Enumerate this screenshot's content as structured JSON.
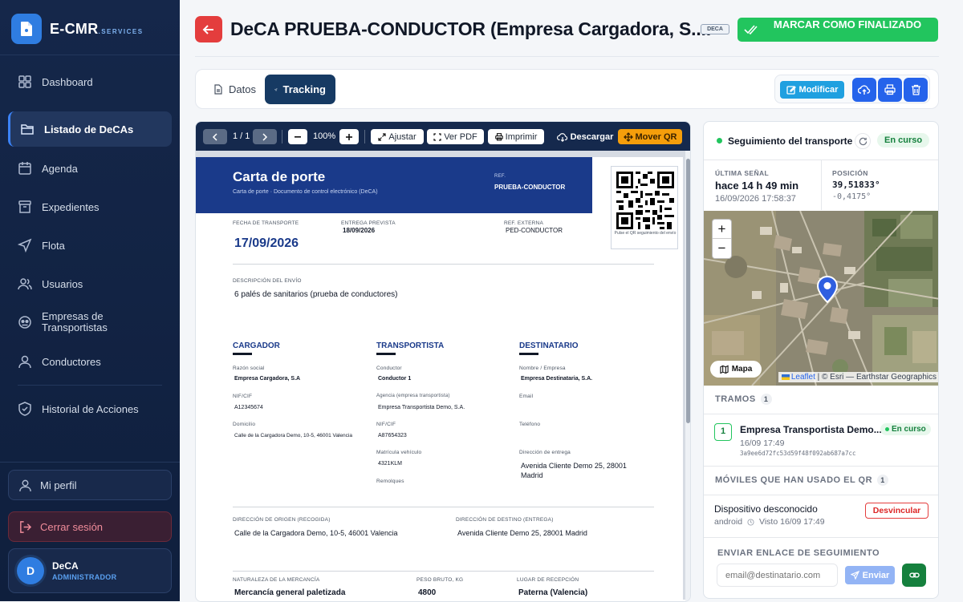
{
  "app": {
    "name": "E-CMR",
    "suffix": ".SERVICES"
  },
  "sidebar": {
    "items": [
      {
        "label": "Dashboard",
        "icon": "grid-icon"
      },
      {
        "label": "Listado de DeCAs",
        "icon": "folder-icon"
      },
      {
        "label": "Agenda",
        "icon": "calendar-icon"
      },
      {
        "label": "Expedientes",
        "icon": "archive-icon"
      },
      {
        "label": "Flota",
        "icon": "navigation-icon"
      },
      {
        "label": "Usuarios",
        "icon": "users-icon"
      },
      {
        "label": "Empresas de Transportistas",
        "icon": "company-icon"
      },
      {
        "label": "Conductores",
        "icon": "user-icon"
      },
      {
        "label": "Historial de Acciones",
        "icon": "shield-icon"
      }
    ],
    "active_index": 1,
    "profile_label": "Mi perfil",
    "logout_label": "Cerrar sesión",
    "user": {
      "initial": "D",
      "name": "DeCA",
      "role": "ADMINISTRADOR"
    }
  },
  "header": {
    "title": "DeCA PRUEBA-CONDUCTOR (Empresa Cargadora, S....",
    "badge": "DECA",
    "finish_label": "MARCAR COMO FINALIZADO"
  },
  "tabs": {
    "datos": "Datos",
    "tracking": "Tracking",
    "modify": "Modificar"
  },
  "pdf": {
    "toolbar": {
      "page": "1 / 1",
      "zoom": "100%",
      "fit": "Ajustar",
      "view_pdf": "Ver PDF",
      "print": "Imprimir",
      "download": "Descargar",
      "move_qr": "Mover QR"
    },
    "doc": {
      "title": "Carta de porte",
      "subtitle": "Carta de porte · Documento de control electrónico (DeCA)",
      "ref_label": "REF.",
      "ref_value": "PRUEBA-CONDUCTOR",
      "qr_caption": "Pulse el QR seguimiento del envío",
      "fecha_label": "FECHA DE TRANSPORTE",
      "fecha_value": "17/09/2026",
      "entrega_label": "ENTREGA PREVISTA",
      "entrega_value": "18/09/2026",
      "refext_label": "REF. EXTERNA",
      "refext_value": "PED-CONDUCTOR",
      "desc_label": "DESCRIPCIÓN DEL ENVÍO",
      "desc_value": "6 palés de sanitarios (prueba de conductores)",
      "cargador": {
        "title": "CARGADOR",
        "razon_label": "Razón social",
        "razon": "Empresa Cargadora, S.A",
        "nif_label": "NIF/CIF",
        "nif": "A12345674",
        "dom_label": "Domicilio",
        "dom": "Calle de la Cargadora Demo, 10-5, 46001 Valencia"
      },
      "transportista": {
        "title": "TRANSPORTISTA",
        "cond_label": "Conductor",
        "cond": "Conductor 1",
        "ag_label": "Agencia (empresa transportista)",
        "ag": "Empresa Transportista Demo, S.A.",
        "nif_label": "NIF/CIF",
        "nif": "A87654323",
        "mat_label": "Matrícula vehículo",
        "mat": "4321KLM",
        "rem_label": "Remolques"
      },
      "destinatario": {
        "title": "DESTINATARIO",
        "nom_label": "Nombre / Empresa",
        "nom": "Empresa Destinataria, S.A.",
        "email_label": "Email",
        "tel_label": "Teléfono",
        "dir_label": "Dirección de entrega",
        "dir": "Avenida Cliente Demo 25, 28001 Madrid"
      },
      "origen_label": "DIRECCIÓN DE ORIGEN (RECOGIDA)",
      "origen": "Calle de la Cargadora Demo, 10-5, 46001 Valencia",
      "destino_label": "DIRECCIÓN DE DESTINO (ENTREGA)",
      "destino": "Avenida Cliente Demo 25, 28001 Madrid",
      "nat_label": "NATURALEZA DE LA MERCANCÍA",
      "nat": "Mercancía general paletizada",
      "peso_label": "PESO BRUTO, KG",
      "peso": "4800",
      "lugar_label": "LUGAR DE RECEPCIÓN",
      "lugar": "Paterna (Valencia)"
    }
  },
  "tracking": {
    "title": "Seguimiento del transporte",
    "status": "En curso",
    "last_signal_label": "ÚLTIMA SEÑAL",
    "last_signal": "hace 14 h 49 min",
    "last_signal_time": "16/09/2026 17:58:37",
    "position_label": "POSICIÓN",
    "lat": "39,51833°",
    "lon": "-0,4175°",
    "map": {
      "zoom_in": "+",
      "zoom_out": "−",
      "layer_btn": "Mapa",
      "leaflet": "Leaflet",
      "attribution": "| © Esri — Earthstar Geographics"
    },
    "tramos_label": "TRAMOS",
    "tramos_count": "1",
    "tramo": {
      "index": "1",
      "name": "Empresa Transportista Demo...",
      "status": "En curso",
      "time": "16/09 17:49",
      "hash": "3a9ee6d72fc53d59f48f092ab687a7cc"
    },
    "moviles_label": "MÓVILES QUE HAN USADO EL QR",
    "moviles_count": "1",
    "device": {
      "name": "Dispositivo desconocido",
      "os": "android",
      "seen": "Visto 16/09 17:49",
      "unlink": "Desvincular"
    },
    "send_label": "ENVIAR ENLACE DE SEGUIMIENTO",
    "email_placeholder": "email@destinatario.com",
    "send_btn": "Enviar"
  },
  "colors": {
    "accent": "#2563eb",
    "success": "#22c55e",
    "danger": "#e43d3d",
    "navy": "#15294d"
  }
}
